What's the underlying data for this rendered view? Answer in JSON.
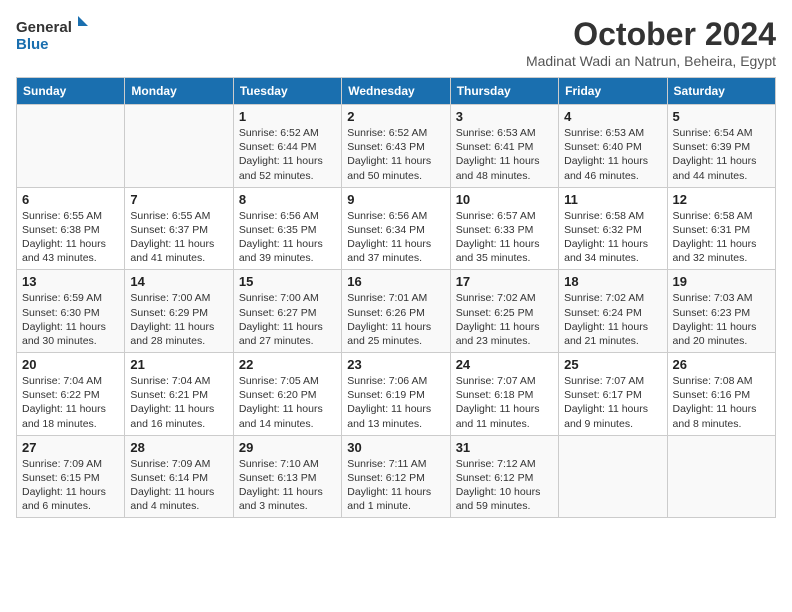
{
  "header": {
    "logo_line1": "General",
    "logo_line2": "Blue",
    "month": "October 2024",
    "location": "Madinat Wadi an Natrun, Beheira, Egypt"
  },
  "days_of_week": [
    "Sunday",
    "Monday",
    "Tuesday",
    "Wednesday",
    "Thursday",
    "Friday",
    "Saturday"
  ],
  "weeks": [
    [
      {
        "day": "",
        "info": ""
      },
      {
        "day": "",
        "info": ""
      },
      {
        "day": "1",
        "info": "Sunrise: 6:52 AM\nSunset: 6:44 PM\nDaylight: 11 hours and 52 minutes."
      },
      {
        "day": "2",
        "info": "Sunrise: 6:52 AM\nSunset: 6:43 PM\nDaylight: 11 hours and 50 minutes."
      },
      {
        "day": "3",
        "info": "Sunrise: 6:53 AM\nSunset: 6:41 PM\nDaylight: 11 hours and 48 minutes."
      },
      {
        "day": "4",
        "info": "Sunrise: 6:53 AM\nSunset: 6:40 PM\nDaylight: 11 hours and 46 minutes."
      },
      {
        "day": "5",
        "info": "Sunrise: 6:54 AM\nSunset: 6:39 PM\nDaylight: 11 hours and 44 minutes."
      }
    ],
    [
      {
        "day": "6",
        "info": "Sunrise: 6:55 AM\nSunset: 6:38 PM\nDaylight: 11 hours and 43 minutes."
      },
      {
        "day": "7",
        "info": "Sunrise: 6:55 AM\nSunset: 6:37 PM\nDaylight: 11 hours and 41 minutes."
      },
      {
        "day": "8",
        "info": "Sunrise: 6:56 AM\nSunset: 6:35 PM\nDaylight: 11 hours and 39 minutes."
      },
      {
        "day": "9",
        "info": "Sunrise: 6:56 AM\nSunset: 6:34 PM\nDaylight: 11 hours and 37 minutes."
      },
      {
        "day": "10",
        "info": "Sunrise: 6:57 AM\nSunset: 6:33 PM\nDaylight: 11 hours and 35 minutes."
      },
      {
        "day": "11",
        "info": "Sunrise: 6:58 AM\nSunset: 6:32 PM\nDaylight: 11 hours and 34 minutes."
      },
      {
        "day": "12",
        "info": "Sunrise: 6:58 AM\nSunset: 6:31 PM\nDaylight: 11 hours and 32 minutes."
      }
    ],
    [
      {
        "day": "13",
        "info": "Sunrise: 6:59 AM\nSunset: 6:30 PM\nDaylight: 11 hours and 30 minutes."
      },
      {
        "day": "14",
        "info": "Sunrise: 7:00 AM\nSunset: 6:29 PM\nDaylight: 11 hours and 28 minutes."
      },
      {
        "day": "15",
        "info": "Sunrise: 7:00 AM\nSunset: 6:27 PM\nDaylight: 11 hours and 27 minutes."
      },
      {
        "day": "16",
        "info": "Sunrise: 7:01 AM\nSunset: 6:26 PM\nDaylight: 11 hours and 25 minutes."
      },
      {
        "day": "17",
        "info": "Sunrise: 7:02 AM\nSunset: 6:25 PM\nDaylight: 11 hours and 23 minutes."
      },
      {
        "day": "18",
        "info": "Sunrise: 7:02 AM\nSunset: 6:24 PM\nDaylight: 11 hours and 21 minutes."
      },
      {
        "day": "19",
        "info": "Sunrise: 7:03 AM\nSunset: 6:23 PM\nDaylight: 11 hours and 20 minutes."
      }
    ],
    [
      {
        "day": "20",
        "info": "Sunrise: 7:04 AM\nSunset: 6:22 PM\nDaylight: 11 hours and 18 minutes."
      },
      {
        "day": "21",
        "info": "Sunrise: 7:04 AM\nSunset: 6:21 PM\nDaylight: 11 hours and 16 minutes."
      },
      {
        "day": "22",
        "info": "Sunrise: 7:05 AM\nSunset: 6:20 PM\nDaylight: 11 hours and 14 minutes."
      },
      {
        "day": "23",
        "info": "Sunrise: 7:06 AM\nSunset: 6:19 PM\nDaylight: 11 hours and 13 minutes."
      },
      {
        "day": "24",
        "info": "Sunrise: 7:07 AM\nSunset: 6:18 PM\nDaylight: 11 hours and 11 minutes."
      },
      {
        "day": "25",
        "info": "Sunrise: 7:07 AM\nSunset: 6:17 PM\nDaylight: 11 hours and 9 minutes."
      },
      {
        "day": "26",
        "info": "Sunrise: 7:08 AM\nSunset: 6:16 PM\nDaylight: 11 hours and 8 minutes."
      }
    ],
    [
      {
        "day": "27",
        "info": "Sunrise: 7:09 AM\nSunset: 6:15 PM\nDaylight: 11 hours and 6 minutes."
      },
      {
        "day": "28",
        "info": "Sunrise: 7:09 AM\nSunset: 6:14 PM\nDaylight: 11 hours and 4 minutes."
      },
      {
        "day": "29",
        "info": "Sunrise: 7:10 AM\nSunset: 6:13 PM\nDaylight: 11 hours and 3 minutes."
      },
      {
        "day": "30",
        "info": "Sunrise: 7:11 AM\nSunset: 6:12 PM\nDaylight: 11 hours and 1 minute."
      },
      {
        "day": "31",
        "info": "Sunrise: 7:12 AM\nSunset: 6:12 PM\nDaylight: 10 hours and 59 minutes."
      },
      {
        "day": "",
        "info": ""
      },
      {
        "day": "",
        "info": ""
      }
    ]
  ]
}
